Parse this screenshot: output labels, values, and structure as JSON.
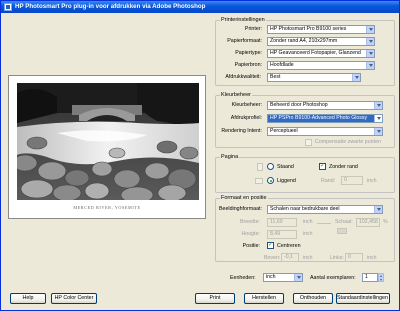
{
  "window": {
    "title": "HP Photosmart Pro plug-in voor afdrukken via Adobe Photoshop"
  },
  "preview": {
    "caption": "MERCED RIVER, YOSEMITE"
  },
  "printer_settings": {
    "group_label": "Printerinstellingen",
    "printer_label": "Printer:",
    "printer_value": "HP Photosmart Pro B9100 series",
    "paper_size_label": "Papierformaat:",
    "paper_size_value": "Zonder rand A4, 210x297mm",
    "paper_type_label": "Papiertype:",
    "paper_type_value": "HP Geavanceerd Fotopapier, Glanzend",
    "paper_source_label": "Papierbron:",
    "paper_source_value": "Hoofdlade",
    "quality_label": "Afdrukkwaliteit:",
    "quality_value": "Best"
  },
  "color_management": {
    "group_label": "Kleurbeheer",
    "manage_label": "Kleurbeheer:",
    "manage_value": "Beheerd door Photoshop",
    "profile_label": "Afdrukprofiel:",
    "profile_value": "HP PSPro B9100-Advanced Photo Glossy",
    "intent_label": "Rendering Intent:",
    "intent_value": "Perceptueel",
    "black_point_label": "Compensatie zwarte punten"
  },
  "page": {
    "group_label": "Pagina",
    "portrait_label": "Staand",
    "landscape_label": "Liggend",
    "borderless_label": "Zonder rand",
    "margin_label": "Rand:",
    "margin_value": "0",
    "margin_unit": "inch"
  },
  "format_position": {
    "group_label": "Formaat en positie",
    "scaling_label": "Beeldinghformaat:",
    "scaling_value": "Schalen naar bedrukbare deel",
    "width_label": "Breedte:",
    "width_value": "11,69",
    "width_unit": "inch",
    "height_label": "Hoogte:",
    "height_value": "8,49",
    "height_unit": "inch",
    "scale_label": "Schaal:",
    "scale_value": "102,458",
    "scale_unit": "%",
    "position_label": "Positie:",
    "center_label": "Centreren",
    "top_label": "Boven:",
    "top_value": "-0,1",
    "top_unit": "inch",
    "left_label": "Links:",
    "left_value": "0",
    "left_unit": "inch"
  },
  "bottom": {
    "units_label": "Eenheden:",
    "units_value": "inch",
    "copies_label": "Aantal exemplaren:",
    "copies_value": "1"
  },
  "buttons": {
    "help": "Help",
    "color_center": "HP Color Center",
    "print": "Print",
    "restore": "Herstellen",
    "remember": "Onthouden",
    "defaults": "Standaardinstellingen herst."
  },
  "colors": {
    "titlebar": "#0a58dc",
    "selection": "#316ac5",
    "checkmark": "#21a121"
  }
}
